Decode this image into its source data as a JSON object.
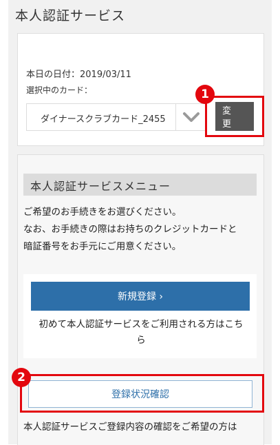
{
  "page_title": "本人認証サービス",
  "card_section": {
    "date_label": "本日の日付：2019/03/11",
    "selected_card_label": "選択中のカード：",
    "selected_card_value": "ダイナースクラブカード_2455",
    "change_button_label": "変 更"
  },
  "annotations": {
    "badge_1": "1",
    "badge_2": "2",
    "highlight_color": "#e3070e"
  },
  "menu": {
    "heading": "本人認証サービスメニュー",
    "info_lines": [
      "ご希望のお手続きをお選びください。",
      "なお、お手続きの際はお持ちのクレジットカードと",
      "暗証番号をお手元にご用意ください。"
    ],
    "register_button_label": "新規登録 ›",
    "register_note_lines": [
      "初めて本人認証サービスをご利用される方はこち",
      "ら"
    ],
    "status_button_label": "登録状況確認",
    "bottom_text": "本人認証サービスご登録内容の確認をご希望の方は"
  },
  "colors": {
    "accent_blue": "#2d6fa9",
    "change_button_bg": "#555555",
    "heading_bg": "#dcdcdc"
  }
}
